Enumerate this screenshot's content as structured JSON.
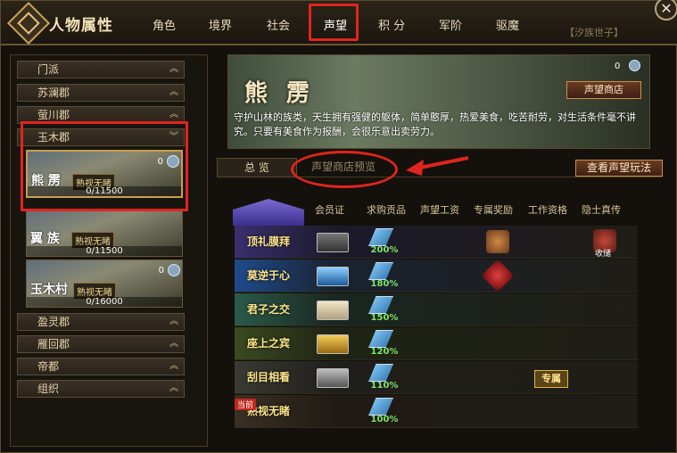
{
  "header": {
    "title": "人物属性",
    "tabs": [
      "角色",
      "境界",
      "社会",
      "声望",
      "积 分",
      "军阶",
      "驱魔"
    ],
    "active_tab": "声望",
    "clan_tag": "【汐族世子】"
  },
  "sidebar": {
    "regions_top": [
      "门派",
      "苏澜郡",
      "萤川郡",
      "玉木郡"
    ],
    "cards": [
      {
        "name": "熊 雳",
        "badge": "熟视无睹",
        "progress": "0/11500",
        "count": "0"
      },
      {
        "name": "翼 族",
        "badge": "熟视无睹",
        "progress": "0/11500",
        "count": ""
      },
      {
        "name": "玉木村",
        "badge": "熟视无睹",
        "progress": "0/16000",
        "count": "0"
      }
    ],
    "regions_bottom": [
      "盈灵郡",
      "雁回郡",
      "帝都",
      "组织"
    ]
  },
  "banner": {
    "name": "熊 雳",
    "count": "0",
    "shop_button": "声望商店",
    "description": "守护山林的族类，天生拥有强健的躯体，简单憨厚，热爱美食，吃苦耐劳，对生活条件毫不讲究。只要有美食作为报酬，会很乐意出卖劳力。"
  },
  "subtabs": {
    "overview": "总 览",
    "preview": "声望商店预览",
    "rules_button": "查看声望玩法"
  },
  "table": {
    "columns": [
      "会员证",
      "求购贡品",
      "声望工资",
      "专属奖励",
      "工作资格",
      "隐士真传"
    ],
    "rows": [
      {
        "label": "顶礼膜拜",
        "pct": "200%"
      },
      {
        "label": "莫逆于心",
        "pct": "180%"
      },
      {
        "label": "君子之交",
        "pct": "150%"
      },
      {
        "label": "座上之宾",
        "pct": "120%"
      },
      {
        "label": "刮目相看",
        "pct": "110%"
      },
      {
        "label": "熟视无睹",
        "pct": "100%"
      }
    ],
    "now_badge": "当前",
    "harvest_label": "收储",
    "exclusive_label": "专属"
  },
  "colors": {
    "highlight": "#e0241e",
    "gold": "#c9a25a",
    "green_pct": "#7de36a"
  }
}
